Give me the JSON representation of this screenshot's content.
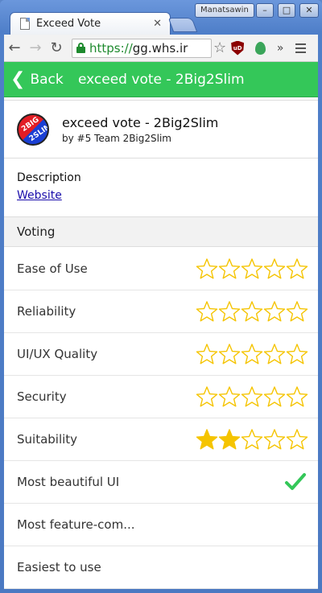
{
  "browser": {
    "tab_title": "Exceed Vote",
    "tab_close": "✕",
    "profile_name": "Manatsawin",
    "window_controls": {
      "minimize": "–",
      "maximize": "□",
      "close": "✕"
    },
    "url_scheme": "https://",
    "url_host": "gg.whs.ir",
    "extensions": [
      "ublock-icon",
      "evernote-leaf-icon"
    ],
    "ublock_label": "uD",
    "overflow_label": "»"
  },
  "appbar": {
    "back_label": "Back",
    "title": "exceed vote - 2Big2Slim",
    "color": "#34c759"
  },
  "project": {
    "name": "exceed vote - 2Big2Slim",
    "team": "by #5 Team 2Big2Slim",
    "logo_text_top": "2BIG",
    "logo_text_bottom": "2SLIM"
  },
  "description": {
    "label": "Description",
    "link_text": "Website"
  },
  "voting": {
    "section_title": "Voting",
    "star_color": "#f5c400",
    "check_color": "#34c759",
    "criteria": [
      {
        "label": "Ease of Use",
        "type": "stars",
        "rating": 0,
        "max": 5
      },
      {
        "label": "Reliability",
        "type": "stars",
        "rating": 0,
        "max": 5
      },
      {
        "label": "UI/UX Quality",
        "type": "stars",
        "rating": 0,
        "max": 5
      },
      {
        "label": "Security",
        "type": "stars",
        "rating": 0,
        "max": 5
      },
      {
        "label": "Suitability",
        "type": "stars",
        "rating": 2,
        "max": 5
      },
      {
        "label": "Most beautiful UI",
        "type": "check",
        "checked": true
      },
      {
        "label": "Most feature-com...",
        "type": "check",
        "checked": false
      },
      {
        "label": "Easiest to use",
        "type": "check",
        "checked": false
      }
    ]
  }
}
